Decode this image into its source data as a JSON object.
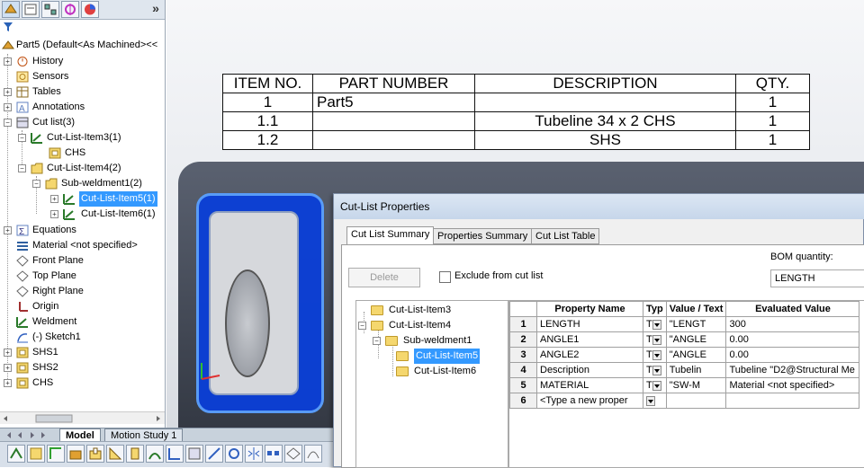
{
  "feature_tree": {
    "more": "»",
    "items": [
      {
        "label": "Part5  (Default<As Machined><<"
      },
      {
        "label": "History"
      },
      {
        "label": "Sensors"
      },
      {
        "label": "Tables"
      },
      {
        "label": "Annotations"
      },
      {
        "label": "Cut list(3)"
      },
      {
        "label": "Cut-List-Item3(1)"
      },
      {
        "label": "CHS"
      },
      {
        "label": "Cut-List-Item4(2)"
      },
      {
        "label": "Sub-weldment1(2)"
      },
      {
        "label": "Cut-List-Item5(1)"
      },
      {
        "label": "Cut-List-Item6(1)"
      },
      {
        "label": "Equations"
      },
      {
        "label": "Material <not specified>"
      },
      {
        "label": "Front Plane"
      },
      {
        "label": "Top Plane"
      },
      {
        "label": "Right Plane"
      },
      {
        "label": "Origin"
      },
      {
        "label": "Weldment"
      },
      {
        "label": "(-) Sketch1"
      },
      {
        "label": "SHS1"
      },
      {
        "label": "SHS2"
      },
      {
        "label": "CHS"
      }
    ]
  },
  "bottom_tabs": {
    "model": "Model",
    "motion": "Motion Study 1"
  },
  "bom_table": {
    "headers": [
      "ITEM NO.",
      "PART NUMBER",
      "DESCRIPTION",
      "QTY."
    ],
    "rows": [
      [
        "1",
        "Part5",
        "",
        "1"
      ],
      [
        "1.1",
        "",
        "Tubeline 34 x 2 CHS",
        "1"
      ],
      [
        "1.2",
        "",
        "SHS",
        "1"
      ]
    ]
  },
  "dialog": {
    "title": "Cut-List Properties",
    "tabs": [
      "Cut List Summary",
      "Properties Summary",
      "Cut List Table"
    ],
    "delete_label": "Delete",
    "exclude_label": "Exclude from cut list",
    "bom_quantity_label": "BOM quantity:",
    "bom_quantity_value": "LENGTH",
    "tree": [
      {
        "label": "Cut-List-Item3"
      },
      {
        "label": "Cut-List-Item4"
      },
      {
        "label": "Sub-weldment1"
      },
      {
        "label": "Cut-List-Item5"
      },
      {
        "label": "Cut-List-Item6"
      }
    ],
    "prop_headers": [
      "Property Name",
      "Typ",
      "Value / Text",
      "Evaluated Value"
    ],
    "prop_rows": [
      {
        "n": "1",
        "name": "LENGTH",
        "type": "T",
        "value": "\"LENGT",
        "eval": "300"
      },
      {
        "n": "2",
        "name": "ANGLE1",
        "type": "T",
        "value": "\"ANGLE",
        "eval": "0.00"
      },
      {
        "n": "3",
        "name": "ANGLE2",
        "type": "T",
        "value": "\"ANGLE",
        "eval": "0.00"
      },
      {
        "n": "4",
        "name": "Description",
        "type": "T",
        "value": "Tubelin",
        "eval": "Tubeline \"D2@Structural Me"
      },
      {
        "n": "5",
        "name": "MATERIAL",
        "type": "T",
        "value": "\"SW-M",
        "eval": "Material <not specified>"
      },
      {
        "n": "6",
        "name": "<Type a new proper",
        "type": "",
        "value": "",
        "eval": ""
      }
    ]
  },
  "colors": {
    "selection": "#3399ff",
    "model_blue": "#0a3fd8",
    "dialog_title": "#c6d6ea"
  }
}
